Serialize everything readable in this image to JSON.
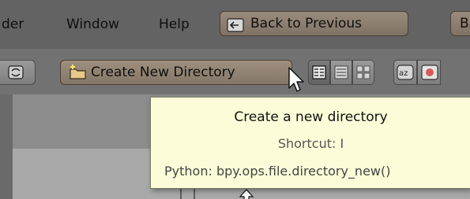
{
  "menubar": {
    "items": [
      "der",
      "Window",
      "Help"
    ],
    "back_button": "Back to Previous",
    "truncated_button": "B"
  },
  "header": {
    "create_dir_button": "Create New Directory",
    "view_buttons": [
      "display-short-list",
      "display-long-list",
      "display-thumbnails"
    ],
    "sort_buttons": [
      "sort-alphabetical",
      "sort-by-extension"
    ]
  },
  "tooltip": {
    "title": "Create a new directory",
    "shortcut": "Shortcut: I",
    "python": "Python: bpy.ops.file.directory_new()"
  },
  "colors": {
    "menubar_bg": "#636363",
    "header_bg": "#727272",
    "tooltip_bg": "#fcfcd8",
    "tooltip_text": "#111111",
    "tooltip_secondary": "#555555"
  }
}
